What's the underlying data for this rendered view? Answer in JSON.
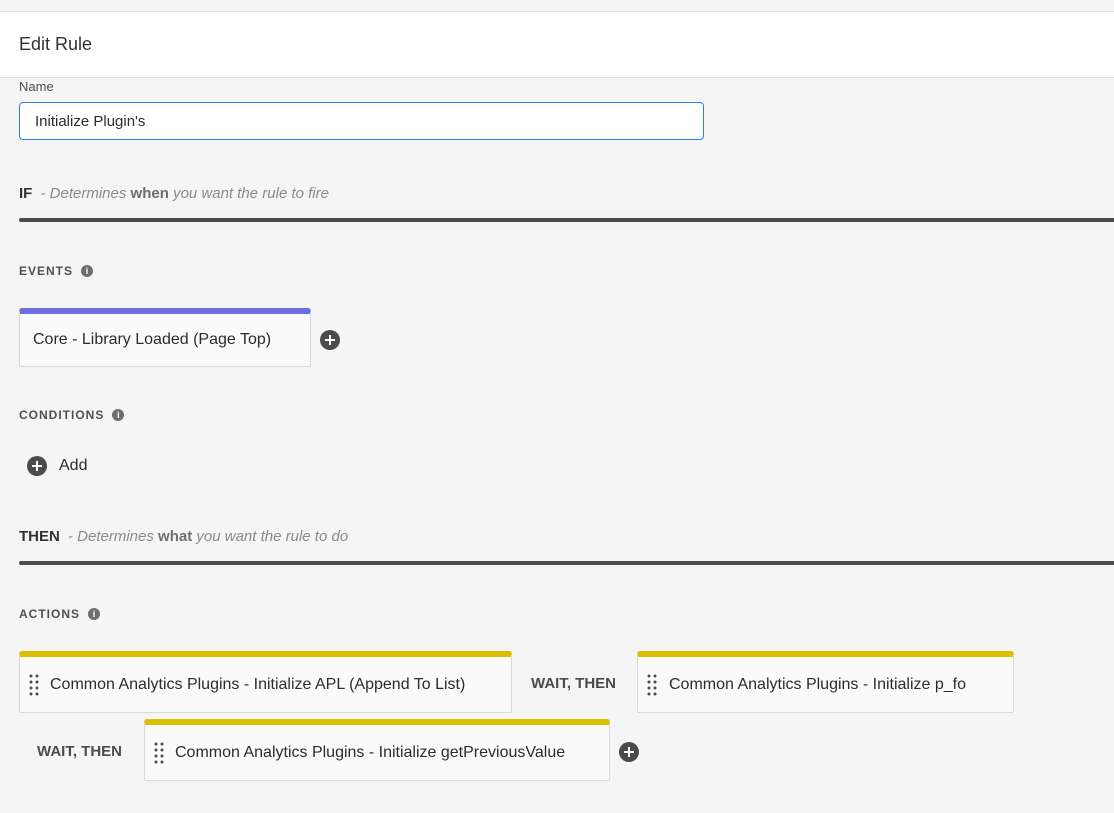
{
  "header": {
    "title": "Edit Rule"
  },
  "name_field": {
    "label": "Name",
    "value": "Initialize Plugin's"
  },
  "if_section": {
    "keyword": "IF",
    "prefix": "- Determines",
    "emphasis": "when",
    "suffix": "you want the rule to fire"
  },
  "events": {
    "label": "EVENTS",
    "info_icon": "info-icon",
    "items": [
      {
        "label": "Core - Library Loaded (Page Top)",
        "accent": "#6e6ee0"
      }
    ]
  },
  "conditions": {
    "label": "CONDITIONS",
    "info_icon": "info-icon",
    "add_label": "Add"
  },
  "then_section": {
    "keyword": "THEN",
    "prefix": "- Determines",
    "emphasis": "what",
    "suffix": "you want the rule to do"
  },
  "actions": {
    "label": "ACTIONS",
    "info_icon": "info-icon",
    "accent": "#d9c100",
    "items": [
      {
        "label": "Common Analytics Plugins - Initialize APL (Append To List)"
      },
      {
        "label": "Common Analytics Plugins - Initialize p_fo"
      },
      {
        "label": "Common Analytics Plugins - Initialize getPreviousValue"
      }
    ],
    "connectors": [
      "WAIT, THEN",
      "WAIT, THEN"
    ]
  },
  "icons": {
    "add": "add-circle-icon",
    "drag": "drag-handle-icon",
    "info": "info-icon"
  },
  "colors": {
    "input_focus": "#2680eb",
    "rule_line": "#4b4b4b",
    "event_accent": "#6e6ee0",
    "action_accent": "#d9c100"
  }
}
